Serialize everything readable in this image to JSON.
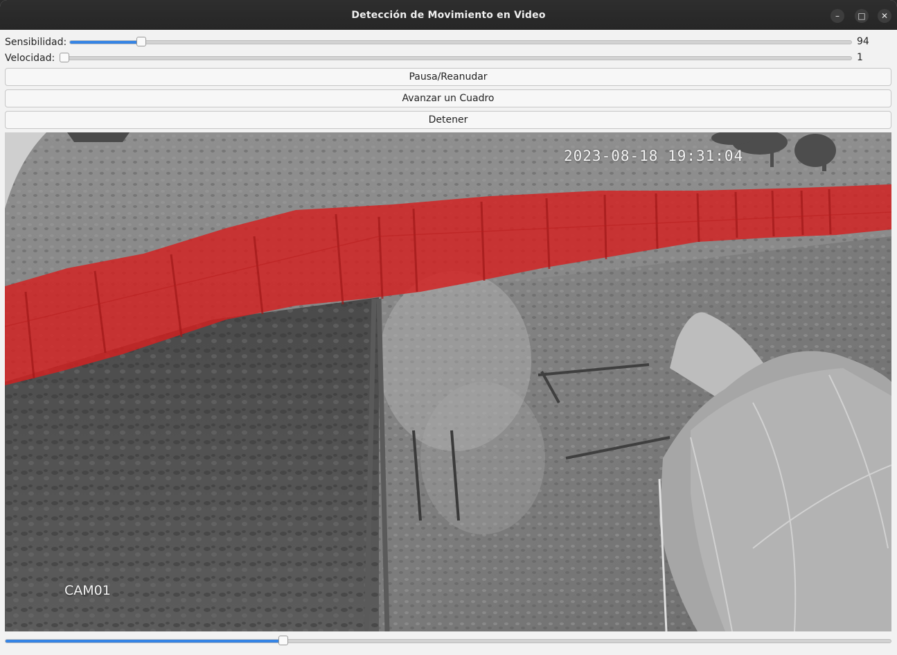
{
  "window": {
    "title": "Detección de Movimiento en Video",
    "minimize_glyph": "–",
    "maximize_glyph": "□",
    "close_glyph": "✕"
  },
  "controls": {
    "sensitivity": {
      "label": "Sensibilidad:",
      "value": "94",
      "fraction": 0.09
    },
    "speed": {
      "label": "Velocidad:",
      "value": "1",
      "fraction": 0.0
    }
  },
  "buttons": {
    "pause_resume": "Pausa/Reanudar",
    "step_frame": "Avanzar un Cuadro",
    "stop": "Detener"
  },
  "video": {
    "timestamp": "2023-08-18 19:31:04",
    "camera_label": "CAM01",
    "motion_overlay_color": "#d42020"
  },
  "playback": {
    "progress_fraction": 0.313
  },
  "colors": {
    "accent": "#3584e4"
  }
}
